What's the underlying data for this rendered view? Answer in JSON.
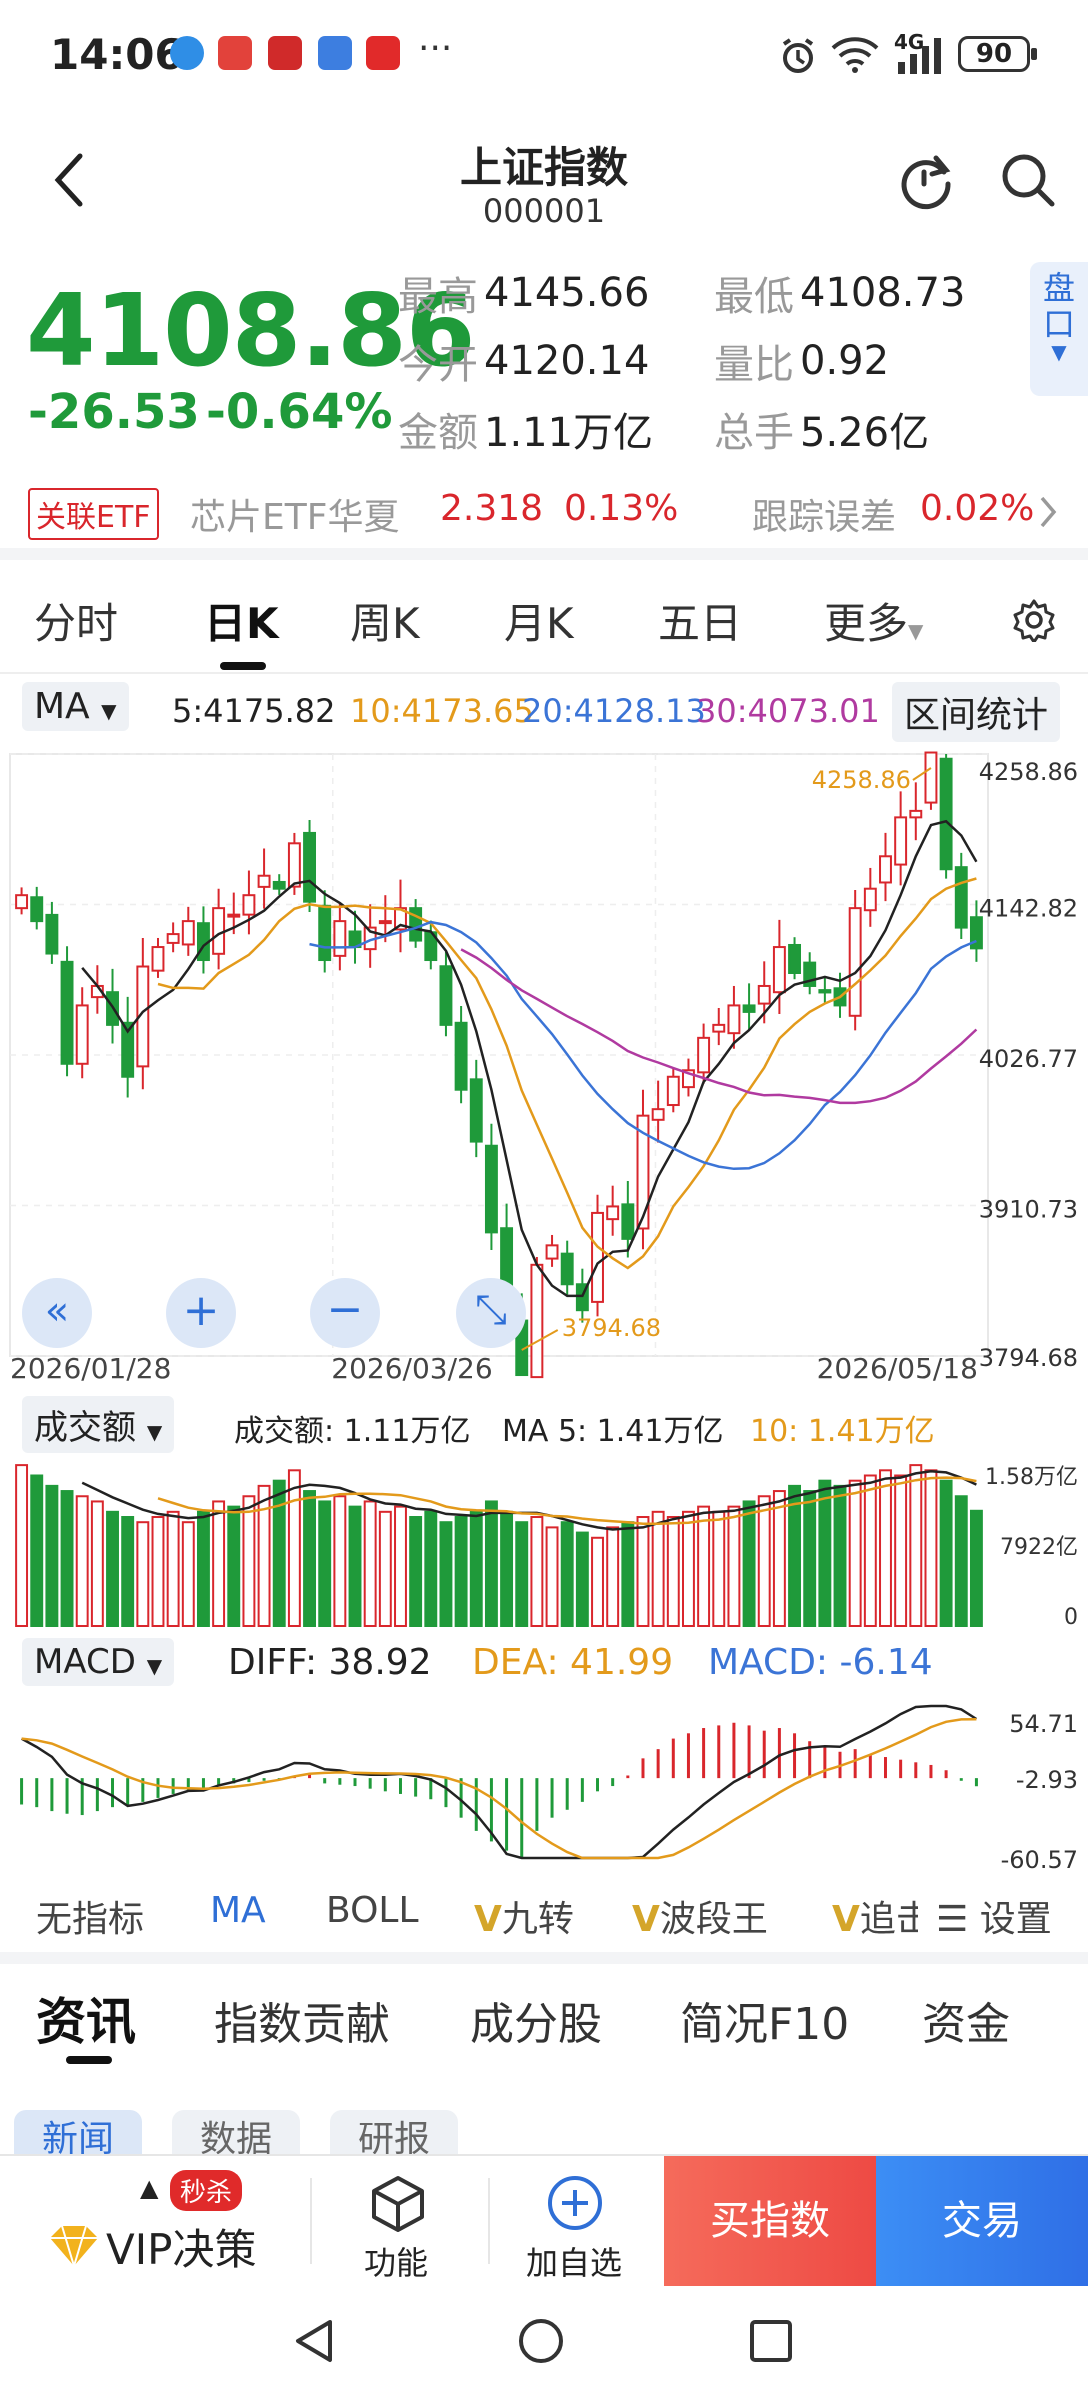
{
  "status_bar": {
    "time": "14:06",
    "network": "4G",
    "battery": "90",
    "more": "···"
  },
  "header": {
    "title": "上证指数",
    "code": "000001"
  },
  "quote": {
    "price": "4108.86",
    "change": "-26.53",
    "change_pct": "-0.64%",
    "stats": [
      {
        "label": "最高",
        "value": "4145.66"
      },
      {
        "label": "最低",
        "value": "4108.73"
      },
      {
        "label": "今开",
        "value": "4120.14"
      },
      {
        "label": "量比",
        "value": "0.92"
      },
      {
        "label": "金额",
        "value": "1.11万亿"
      },
      {
        "label": "总手",
        "value": "5.26亿"
      }
    ],
    "pankou_label": "盘口"
  },
  "etf": {
    "tag": "关联ETF",
    "name": "芯片ETF华夏",
    "price": "2.318",
    "pct": "0.13%",
    "track_label": "跟踪误差",
    "track_value": "0.02%"
  },
  "chart_tabs": [
    "分时",
    "日K",
    "周K",
    "月K",
    "五日",
    "更多"
  ],
  "ma_legend": {
    "selector": "MA",
    "ma5": "5:4175.82",
    "ma10": "10:4173.65",
    "ma20": "20:4128.13",
    "ma30": "30:4073.01",
    "range_stat": "区间统计"
  },
  "colors": {
    "ma5": "#222222",
    "ma10": "#e39a1b",
    "ma20": "#3b74d6",
    "ma30": "#b03aa0",
    "up": "#d9262c",
    "down": "#1f9a3a"
  },
  "kline": {
    "price_axis": [
      "4258.86",
      "4142.82",
      "4026.77",
      "3910.73",
      "3794.68"
    ],
    "dates": [
      "2026/01/28",
      "2026/03/26",
      "2026/05/18"
    ],
    "high_label": "4258.86",
    "low_label": "3794.68"
  },
  "volume": {
    "selector": "成交额",
    "value_text": "成交额: 1.11万亿",
    "ma5_text": "MA 5: 1.41万亿",
    "ma10_text": "10: 1.41万亿",
    "axis": [
      "1.58万亿",
      "7922亿",
      "0"
    ]
  },
  "macd": {
    "selector": "MACD",
    "diff": "DIFF: 38.92",
    "dea": "DEA: 41.99",
    "macd": "MACD: -6.14",
    "axis": [
      "54.71",
      "-2.93",
      "-60.57"
    ]
  },
  "indicators": [
    "无指标",
    "MA",
    "BOLL",
    "九转",
    "波段王",
    "追击",
    "设置"
  ],
  "news_tabs": [
    "资讯",
    "指数贡献",
    "成分股",
    "简况F10",
    "资金"
  ],
  "news_subtabs": [
    "新闻",
    "数据",
    "研报"
  ],
  "bottom_bar": {
    "vip_badge": "秒杀",
    "vip": "VIP决策",
    "func": "功能",
    "add": "加自选",
    "buy": "买指数",
    "trade": "交易"
  },
  "chart_data": [
    {
      "type": "candlestick",
      "title": "上证指数 日K",
      "x_range": [
        "2026/01/28",
        "2026/05/18"
      ],
      "ylim": [
        3794.68,
        4258.86
      ],
      "y_ticks": [
        4258.86,
        4142.82,
        4026.77,
        3910.73,
        3794.68
      ],
      "closes": [
        4150,
        4130,
        4105,
        4020,
        4065,
        4080,
        4050,
        4010,
        4095,
        4110,
        4120,
        4130,
        4100,
        4140,
        4135,
        4150,
        4165,
        4155,
        4190,
        4145,
        4100,
        4130,
        4110,
        4125,
        4130,
        4140,
        4115,
        4100,
        4050,
        4000,
        3960,
        3890,
        3830,
        3780,
        3865,
        3880,
        3850,
        3830,
        3905,
        3910,
        3885,
        3980,
        3985,
        4010,
        4015,
        4040,
        4050,
        4065,
        4060,
        4080,
        4110,
        4090,
        4080,
        4075,
        4065,
        4140,
        4155,
        4180,
        4210,
        4215,
        4260,
        4170,
        4125,
        4109
      ],
      "series": [
        {
          "name": "MA5",
          "last": 4175.82
        },
        {
          "name": "MA10",
          "last": 4173.65
        },
        {
          "name": "MA20",
          "last": 4128.13
        },
        {
          "name": "MA30",
          "last": 4073.01
        }
      ],
      "annotations": [
        {
          "text": "4258.86",
          "type": "high"
        },
        {
          "text": "3794.68",
          "type": "low"
        }
      ]
    },
    {
      "type": "bar",
      "title": "成交额",
      "ylim": [
        0,
        1.58
      ],
      "unit": "万亿",
      "values": [
        1.55,
        1.45,
        1.35,
        1.3,
        1.25,
        1.2,
        1.1,
        1.05,
        1.0,
        1.05,
        1.1,
        1.0,
        1.1,
        1.2,
        1.15,
        1.25,
        1.35,
        1.4,
        1.5,
        1.3,
        1.2,
        1.25,
        1.15,
        1.2,
        1.1,
        1.15,
        1.05,
        1.1,
        1.0,
        1.05,
        1.1,
        1.2,
        1.1,
        1.0,
        1.05,
        0.95,
        1.0,
        0.9,
        0.85,
        0.95,
        1.0,
        1.05,
        1.1,
        1.05,
        1.1,
        1.15,
        1.1,
        1.15,
        1.2,
        1.25,
        1.3,
        1.35,
        1.3,
        1.4,
        1.35,
        1.4,
        1.45,
        1.5,
        1.45,
        1.55,
        1.5,
        1.4,
        1.25,
        1.11
      ],
      "series": [
        {
          "name": "MA 5",
          "last": 1.41
        },
        {
          "name": "10",
          "last": 1.41
        }
      ]
    },
    {
      "type": "bar",
      "title": "MACD",
      "ylim": [
        -60.57,
        54.71
      ],
      "values": [
        -20,
        -22,
        -25,
        -27,
        -28,
        -25,
        -22,
        -20,
        -18,
        -15,
        -12,
        -10,
        -8,
        -6,
        -4,
        -3,
        -2,
        -1,
        2,
        3,
        -4,
        -5,
        -6,
        -8,
        -10,
        -12,
        -14,
        -16,
        -22,
        -30,
        -40,
        -48,
        -55,
        -60,
        -40,
        -30,
        -24,
        -18,
        -10,
        -6,
        2,
        15,
        22,
        30,
        34,
        38,
        40,
        42,
        40,
        36,
        38,
        34,
        28,
        24,
        20,
        22,
        18,
        16,
        14,
        12,
        10,
        6,
        -2,
        -6.14
      ],
      "series": [
        {
          "name": "DIFF",
          "last": 38.92
        },
        {
          "name": "DEA",
          "last": 41.99
        },
        {
          "name": "MACD",
          "last": -6.14
        }
      ]
    }
  ]
}
